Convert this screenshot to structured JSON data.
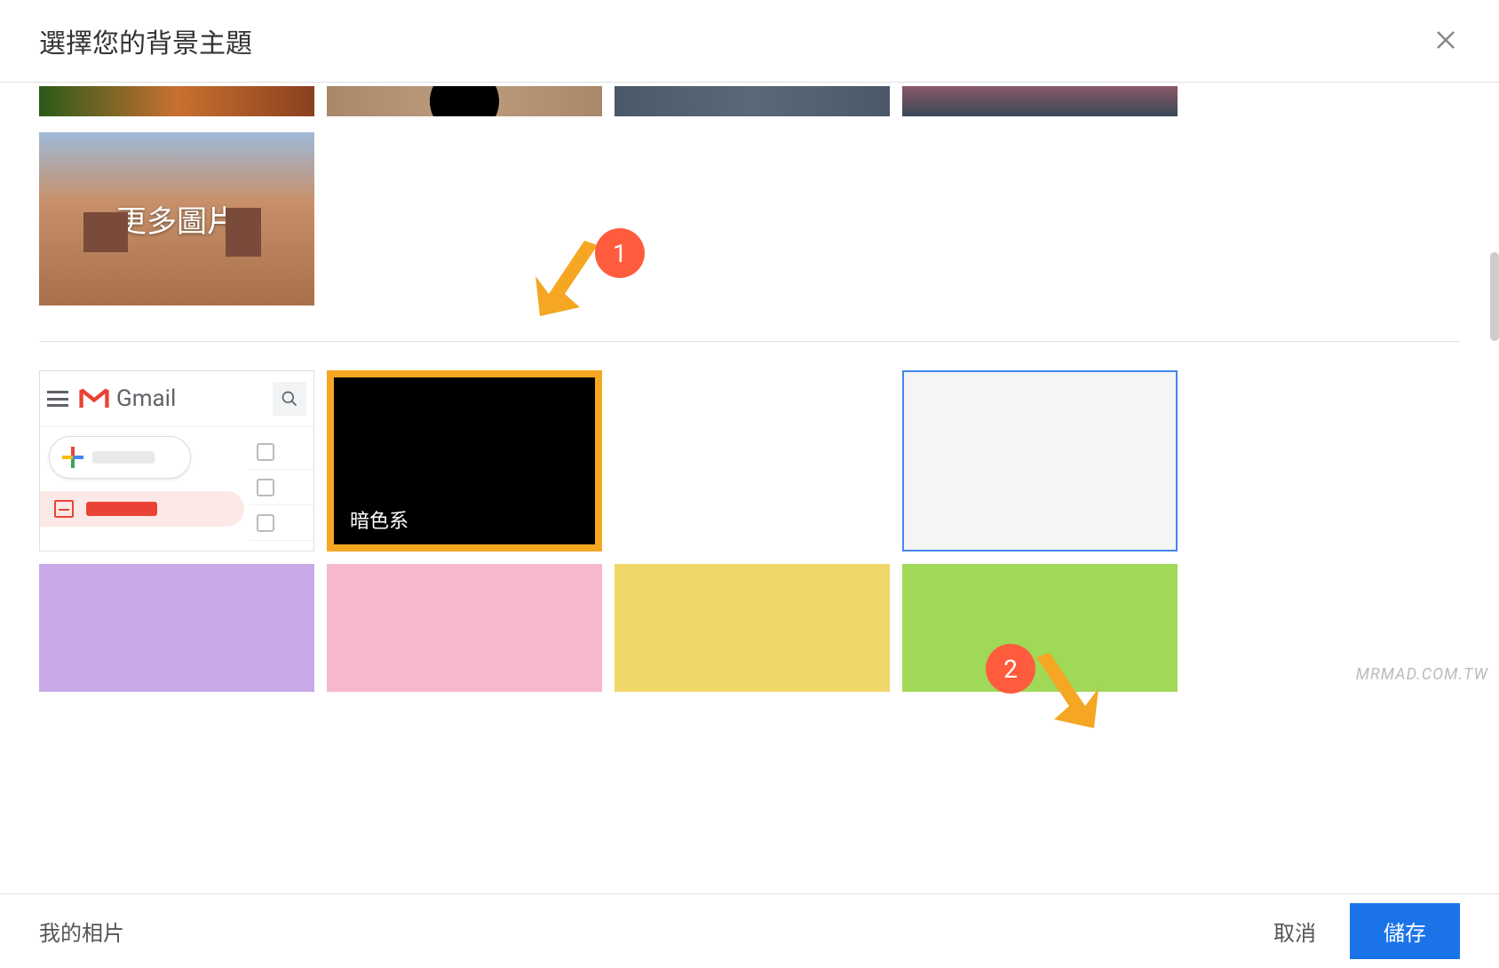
{
  "header": {
    "title": "選擇您的背景主題"
  },
  "more_images": {
    "label": "更多圖片"
  },
  "gmail": {
    "label": "Gmail"
  },
  "themes": {
    "dark": {
      "label": "暗色系",
      "color": "#000000"
    },
    "blue": {
      "color": "#b0d4e8"
    },
    "white": {
      "color": "#f5f5f5"
    },
    "purple": {
      "color": "#c9a9e8"
    },
    "pink": {
      "color": "#f5b8cc"
    },
    "yellow": {
      "color": "#f0d868"
    },
    "green": {
      "color": "#a0d858"
    }
  },
  "annotations": {
    "step1": "1",
    "step2": "2"
  },
  "footer": {
    "my_photos": "我的相片",
    "cancel": "取消",
    "save": "儲存"
  },
  "watermark": "MRMAD.COM.TW"
}
